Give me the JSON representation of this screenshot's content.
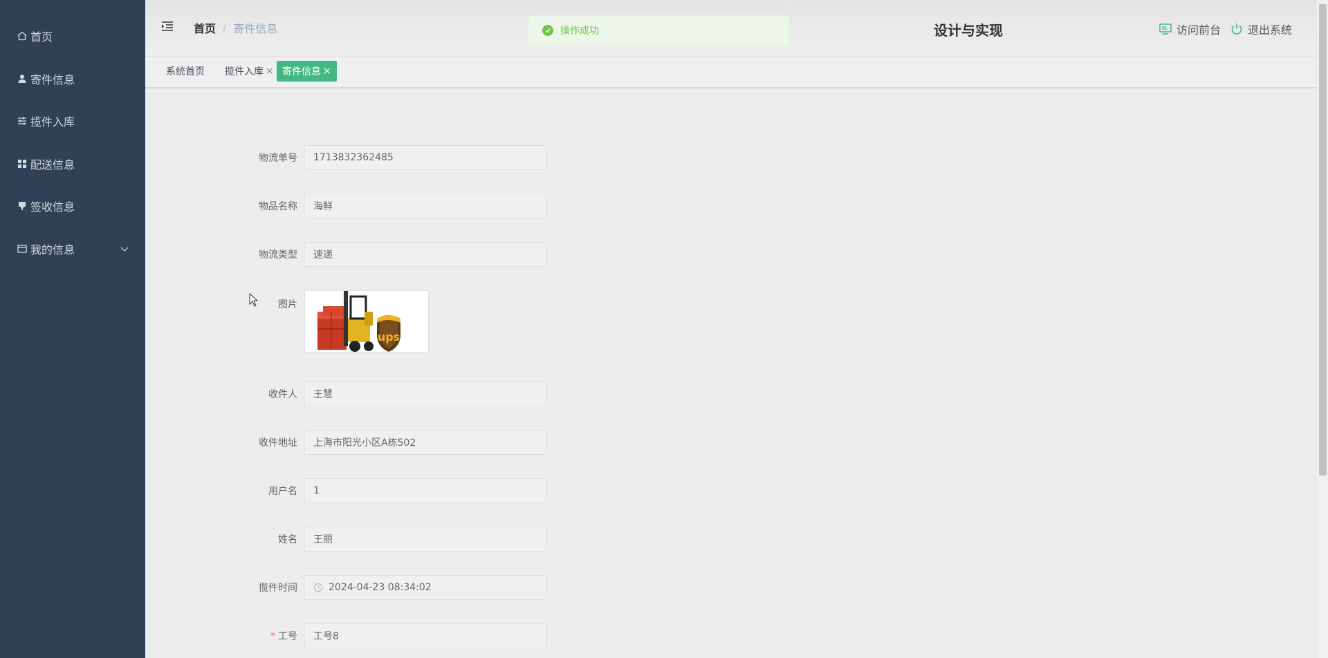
{
  "sidebar": {
    "items": [
      {
        "label": "首页",
        "icon": "home-icon"
      },
      {
        "label": "寄件信息",
        "icon": "user-icon"
      },
      {
        "label": "揽件入库",
        "icon": "sliders-icon"
      },
      {
        "label": "配送信息",
        "icon": "grid-icon"
      },
      {
        "label": "签收信息",
        "icon": "stamp-icon"
      },
      {
        "label": "我的信息",
        "icon": "card-icon"
      }
    ]
  },
  "header": {
    "breadcrumb_home": "首页",
    "breadcrumb_sep": "/",
    "breadcrumb_current": "寄件信息",
    "system_title": "设计与实现",
    "visit_front": "访问前台",
    "logout": "退出系统"
  },
  "toast": {
    "message": "操作成功"
  },
  "tags": [
    {
      "label": "系统首页"
    },
    {
      "label": "揽件入库"
    },
    {
      "label": "寄件信息"
    }
  ],
  "tag_close": "×",
  "form": {
    "fields": [
      {
        "label": "物流单号",
        "value": "1713832362485"
      },
      {
        "label": "物品名称",
        "value": "海鲜"
      },
      {
        "label": "物流类型",
        "value": "速递"
      },
      {
        "label": "图片"
      },
      {
        "label": "收件人",
        "value": "王慧"
      },
      {
        "label": "收件地址",
        "value": "上海市阳光小区A栋502"
      },
      {
        "label": "用户名",
        "value": "1"
      },
      {
        "label": "姓名",
        "value": "王丽"
      },
      {
        "label": "揽件时间",
        "value": "2024-04-23 08:34:02"
      },
      {
        "label": "工号",
        "value": "工号8",
        "required_mark": "*"
      }
    ]
  },
  "image_text": "ups",
  "colors": {
    "sidebar": "#304156",
    "accent": "#42b983",
    "success": "#67c23a"
  }
}
